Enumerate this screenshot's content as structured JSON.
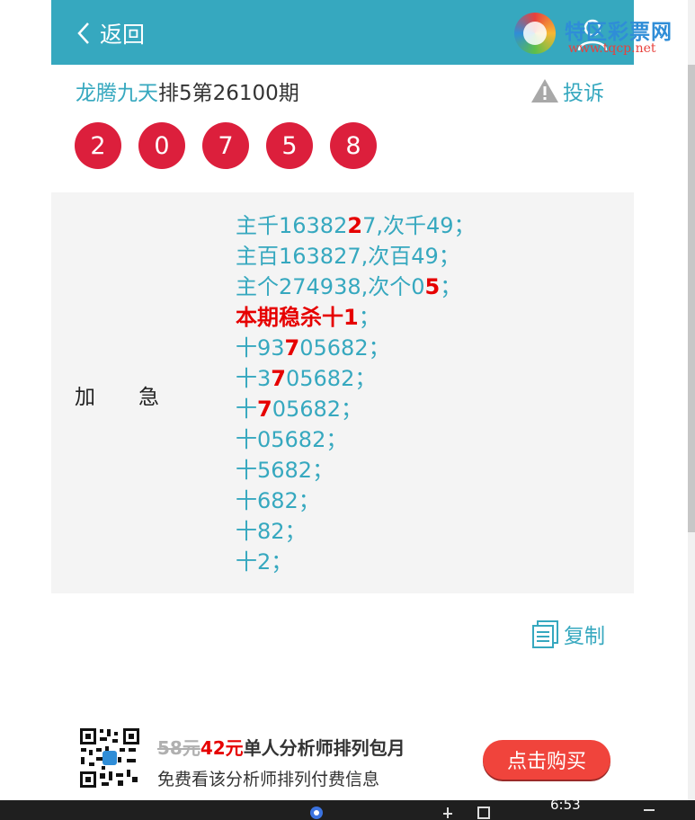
{
  "header": {
    "back_label": "返回",
    "watermark_name": "特区彩票网",
    "watermark_url": "www.tqcp.net"
  },
  "title": {
    "author": "龙腾九天",
    "issue": "排5第26100期"
  },
  "complain_label": "投诉",
  "draw_numbers": [
    "2",
    "0",
    "7",
    "5",
    "8"
  ],
  "panel": {
    "label": "加急",
    "lines": [
      {
        "a": "主千16382",
        "b": "2",
        "c": "7,次千49；",
        "red": false
      },
      {
        "a": "主百163827,次百49；",
        "b": "",
        "c": "",
        "red": false
      },
      {
        "a": "主个274938,次个0",
        "b": "5",
        "c": "；",
        "red": false
      },
      {
        "a": "本期稳杀十1",
        "b": "",
        "c": "；",
        "red": true
      },
      {
        "a": "十93",
        "b": "7",
        "c": "05682；",
        "red": false
      },
      {
        "a": "十3",
        "b": "7",
        "c": "05682；",
        "red": false
      },
      {
        "a": "十",
        "b": "7",
        "c": "05682；",
        "red": false
      },
      {
        "a": "十05682；",
        "b": "",
        "c": "",
        "red": false
      },
      {
        "a": "十5682；",
        "b": "",
        "c": "",
        "red": false
      },
      {
        "a": "十682；",
        "b": "",
        "c": "",
        "red": false
      },
      {
        "a": "十82；",
        "b": "",
        "c": "",
        "red": false
      },
      {
        "a": "十2；",
        "b": "",
        "c": "",
        "red": false
      }
    ]
  },
  "copy_label": "复制",
  "promo": {
    "old_price": "58元",
    "new_price": "42元",
    "title": "单人分析师排列包月",
    "desc": "免费看该分析师排列付费信息",
    "buy_label": "点击购买"
  },
  "taskbar": {
    "time": "6:53"
  },
  "colors": {
    "header_bg": "#36a8bf",
    "ball": "#dc1f3c",
    "highlight": "#e60000",
    "buy_button": "#f0443c"
  }
}
